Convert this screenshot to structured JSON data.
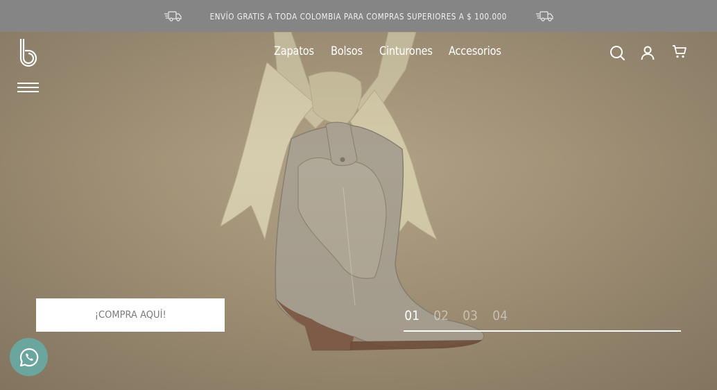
{
  "announcement": {
    "text": "ENVÍO GRATIS A TODA COLOMBIA PARA COMPRAS SUPERIORES A $ 100.000",
    "icon": "delivery-truck-icon"
  },
  "header": {
    "logo_icon": "brand-b-logo",
    "menu_icon": "hamburger-menu-icon",
    "nav": [
      "Zapatos",
      "Bolsos",
      "Cinturones",
      "Accesorios"
    ],
    "icons": [
      "search-icon",
      "user-icon",
      "cart-icon"
    ]
  },
  "hero": {
    "cta_label": "¡COMPRA AQUÍ!",
    "slides": [
      "01",
      "02",
      "03",
      "04"
    ],
    "active_slide": "01"
  },
  "whatsapp": {
    "icon": "whatsapp-icon"
  },
  "colors": {
    "topbar": "#858585",
    "whatsapp": "#6aa59e",
    "cta_bg": "#ffffff",
    "cta_text": "#7a7a7a"
  }
}
